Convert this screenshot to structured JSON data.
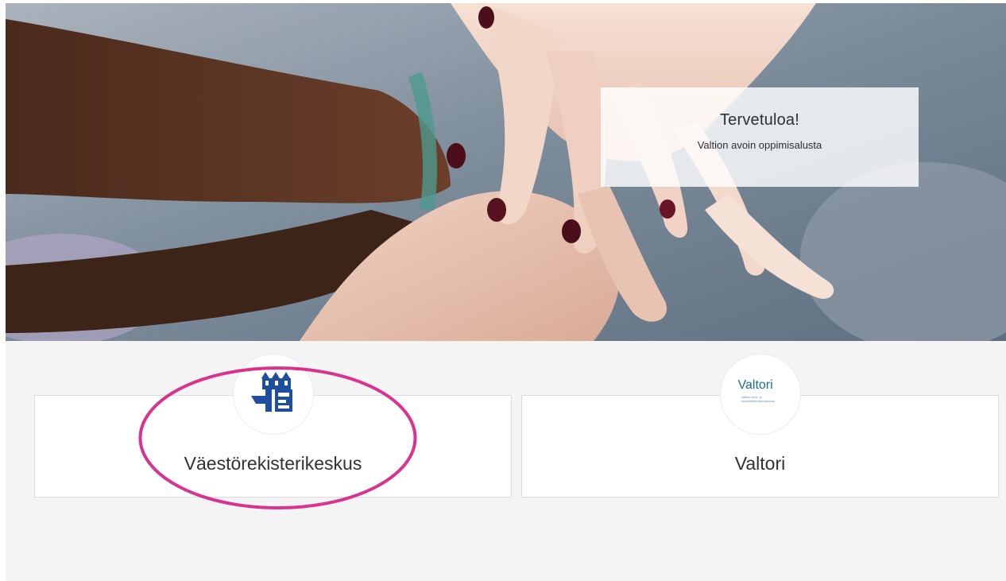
{
  "welcome": {
    "title": "Tervetuloa!",
    "subtitle": "Valtion avoin oppimisalusta"
  },
  "organizations": [
    {
      "name": "Väestörekisterikeskus",
      "logo_icon": "vrk-building-logo-icon"
    },
    {
      "name": "Valtori",
      "logo_icon": "valtori-logo-icon",
      "logo_text": "Valtori",
      "logo_tagline": "Valtion tieto- ja viestintätekniikkakeskus"
    }
  ],
  "colors": {
    "highlight_ring": "#d9338f",
    "content_background": "#f4f4f4",
    "vrk_logo_blue": "#1f4e9c",
    "valtori_teal": "#1a6f8e"
  }
}
